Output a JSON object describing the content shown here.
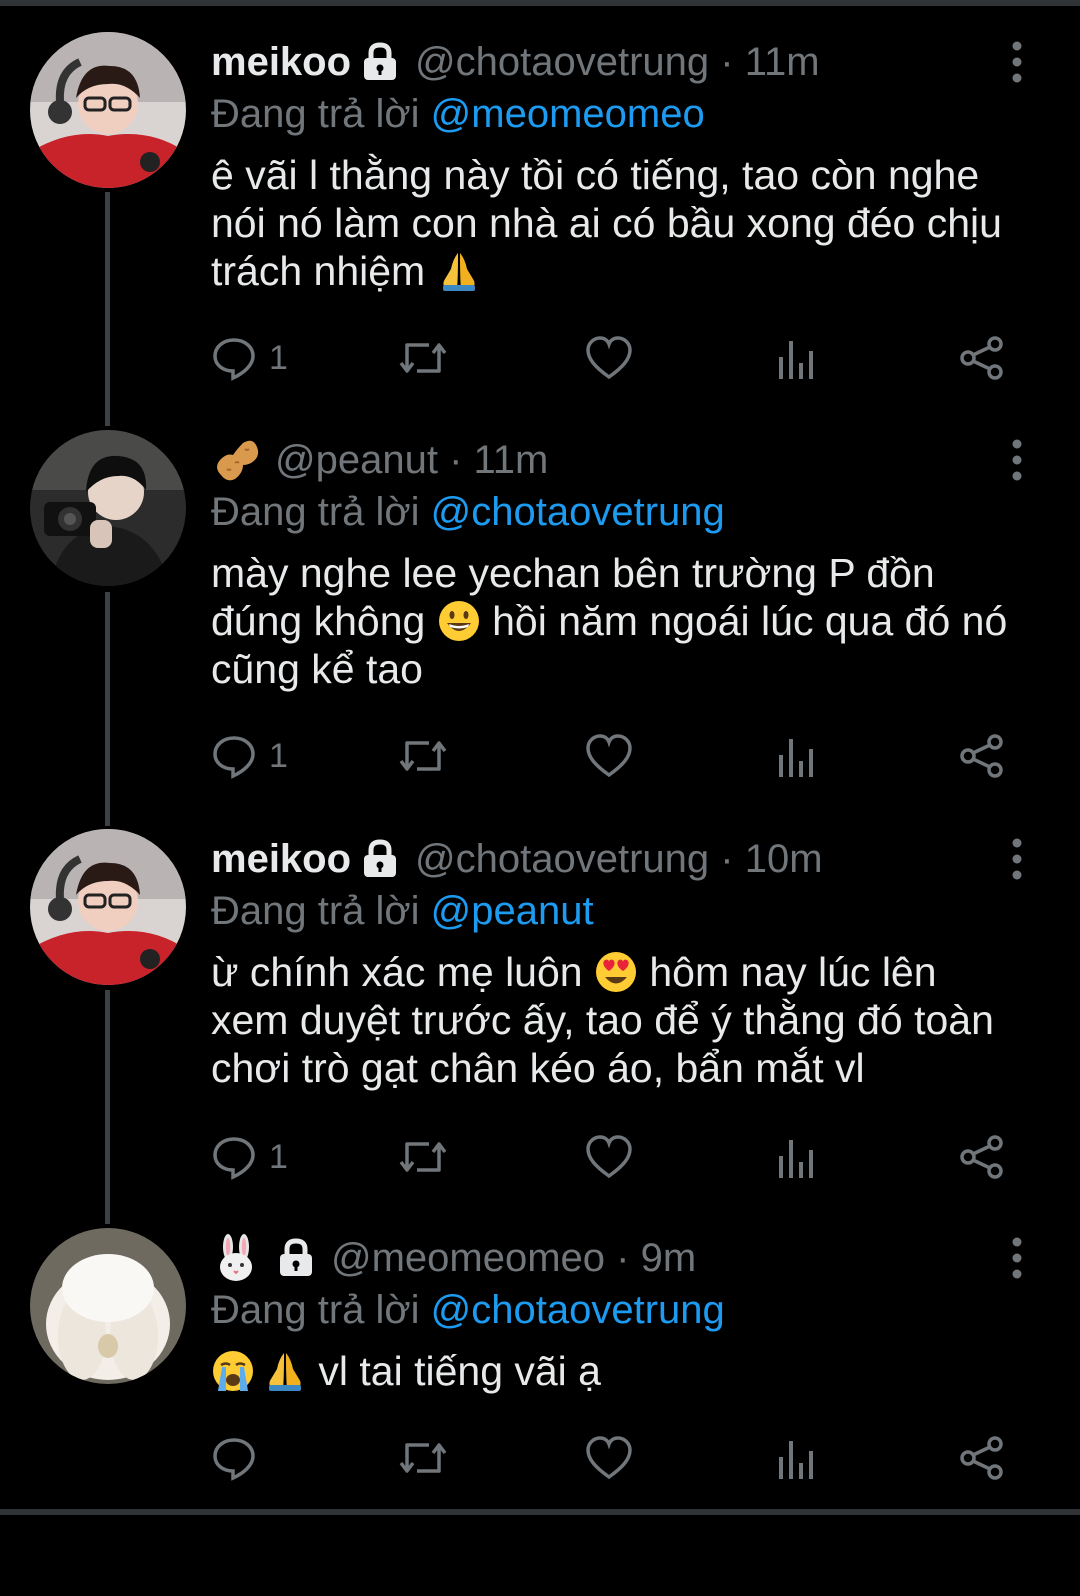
{
  "colors": {
    "background": "#000000",
    "text": "#e7e9ea",
    "muted": "#71767b",
    "link": "#1d9bf0",
    "thread_line": "#3e4144"
  },
  "reply_prefix": "Đang trả lời",
  "tweets": [
    {
      "display_name": "meikoo",
      "name_icon": "lock-icon",
      "handle": "@chotaovetrung",
      "time": "11m",
      "reply_to": "@meomeomeo",
      "lines": [
        "ê vãi l thằng này tồi có tiếng, tao còn nghe",
        "nói nó làm con nhà ai có bầu xong đéo chịu",
        "trách nhiệm "
      ],
      "line_emoji": [
        null,
        null,
        "folded-hands-emoji"
      ],
      "reply_count": "1"
    },
    {
      "display_name": "",
      "name_icon": "peanut-emoji",
      "handle": "@peanut",
      "time": "11m",
      "reply_to": "@chotaovetrung",
      "lines": [
        "mày nghe lee yechan bên trường P đồn",
        "đúng không ",
        "cũng kể tao"
      ],
      "line_2_tail": " hồi năm ngoái lúc qua đó nó",
      "line_emoji": [
        null,
        "grinning-face-emoji",
        null
      ],
      "reply_count": "1"
    },
    {
      "display_name": "meikoo",
      "name_icon": "lock-icon",
      "handle": "@chotaovetrung",
      "time": "10m",
      "reply_to": "@peanut",
      "lines": [
        "ừ chính xác mẹ luôn ",
        "xem duyệt trước ấy, tao để ý thằng đó toàn",
        "chơi trò gạt chân kéo áo, bẩn mắt vl"
      ],
      "line_1_tail": " hôm nay lúc lên",
      "line_emoji": [
        "heart-eyes-emoji",
        null,
        null
      ],
      "reply_count": "1"
    },
    {
      "display_name": "",
      "name_icon": "rabbit-emoji",
      "handle": "@meomeomeo",
      "time": "9m",
      "reply_to": "@chotaovetrung",
      "lines": [
        " vl tai tiếng vãi ạ"
      ],
      "reply_count": ""
    }
  ]
}
